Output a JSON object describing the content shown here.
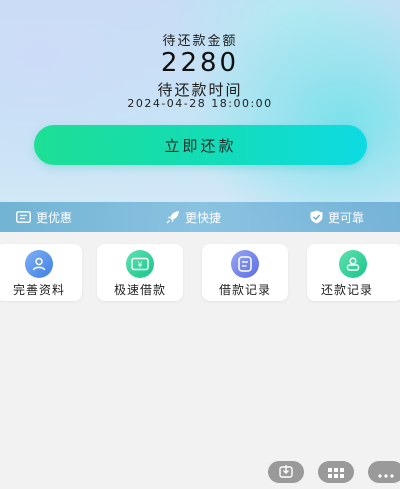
{
  "repayment": {
    "amount_label": "待还款金额",
    "amount": "2280",
    "due_label": "待还款时间",
    "due_time": "2024-04-28 18:00:00",
    "repay_button": "立即还款"
  },
  "features": [
    {
      "label": "更优惠",
      "icon": "ticket-icon"
    },
    {
      "label": "更快捷",
      "icon": "rocket-icon"
    },
    {
      "label": "更可靠",
      "icon": "shield-check-icon"
    }
  ],
  "shortcuts": [
    {
      "label": "完善资料",
      "icon": "profile-icon",
      "color": "#4a8ae8"
    },
    {
      "label": "极速借款",
      "icon": "money-icon",
      "color": "#20c98a"
    },
    {
      "label": "借款记录",
      "icon": "record-icon",
      "color": "#6a7ce8"
    },
    {
      "label": "还款记录",
      "icon": "repay-record-icon",
      "color": "#20c98a"
    }
  ],
  "floating_buttons": [
    "download-icon",
    "grid-icon",
    "more-icon"
  ],
  "colors": {
    "button_start": "#1ddf95",
    "button_end": "#0edbe3",
    "background": "#f2f2f2"
  }
}
